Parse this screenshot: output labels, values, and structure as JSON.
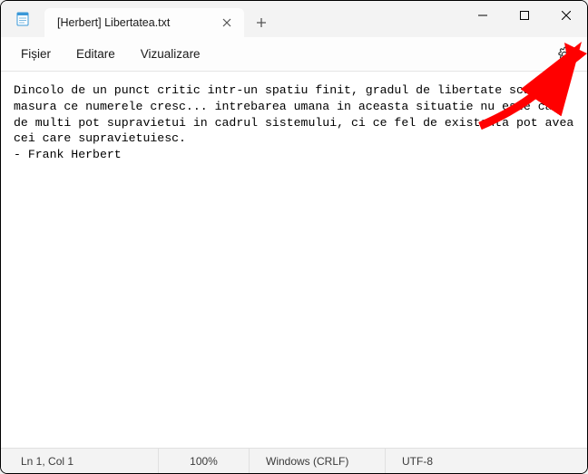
{
  "tab": {
    "title": "[Herbert] Libertatea.txt"
  },
  "menu": {
    "file": "Fișier",
    "edit": "Editare",
    "view": "Vizualizare"
  },
  "content": "Dincolo de un punct critic intr-un spatiu finit, gradul de libertate scade pe masura ce numerele cresc... intrebarea umana in aceasta situatie nu este cat de multi pot supravietui in cadrul sistemului, ci ce fel de existenta pot avea cei care supravietuiesc.\n- Frank Herbert",
  "status": {
    "position": "Ln 1, Col 1",
    "zoom": "100%",
    "eol": "Windows (CRLF)",
    "encoding": "UTF-8"
  }
}
